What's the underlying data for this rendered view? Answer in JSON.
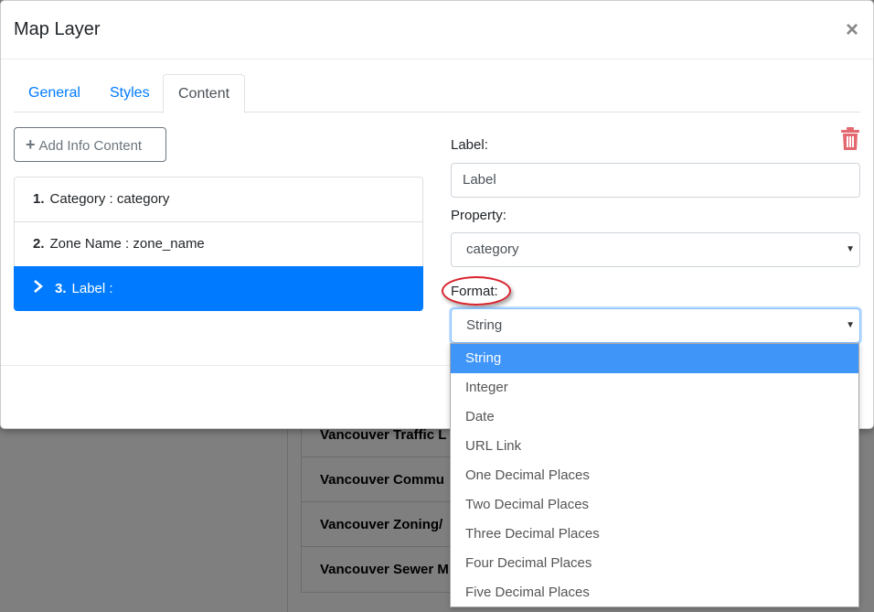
{
  "modal": {
    "title": "Map Layer",
    "close_label": "×"
  },
  "tabs": [
    {
      "label": "General",
      "active": false
    },
    {
      "label": "Styles",
      "active": false
    },
    {
      "label": "Content",
      "active": true
    }
  ],
  "add_button": {
    "icon": "plus-icon",
    "label": "Add Info Content"
  },
  "info_items": [
    {
      "num": "1.",
      "text": "Category : category",
      "active": false
    },
    {
      "num": "2.",
      "text": "Zone Name : zone_name",
      "active": false
    },
    {
      "num": "3.",
      "text": "Label :",
      "active": true
    }
  ],
  "form": {
    "label_title": "Label:",
    "label_value": "Label",
    "property_title": "Property:",
    "property_value": "category",
    "format_title": "Format:",
    "format_value": "String"
  },
  "format_options": [
    "String",
    "Integer",
    "Date",
    "URL Link",
    "One Decimal Places",
    "Two Decimal Places",
    "Three Decimal Places",
    "Four Decimal Places",
    "Five Decimal Places"
  ],
  "selected_format_index": 0,
  "background_list": [
    "Vancouver Traffic L",
    "Vancouver Commu",
    "Vancouver Zoning/",
    "Vancouver Sewer M"
  ],
  "colors": {
    "accent": "#007bff",
    "danger_icon": "#e4686f",
    "highlight_ring": "#d9232e",
    "option_selected": "#3f95f8"
  }
}
